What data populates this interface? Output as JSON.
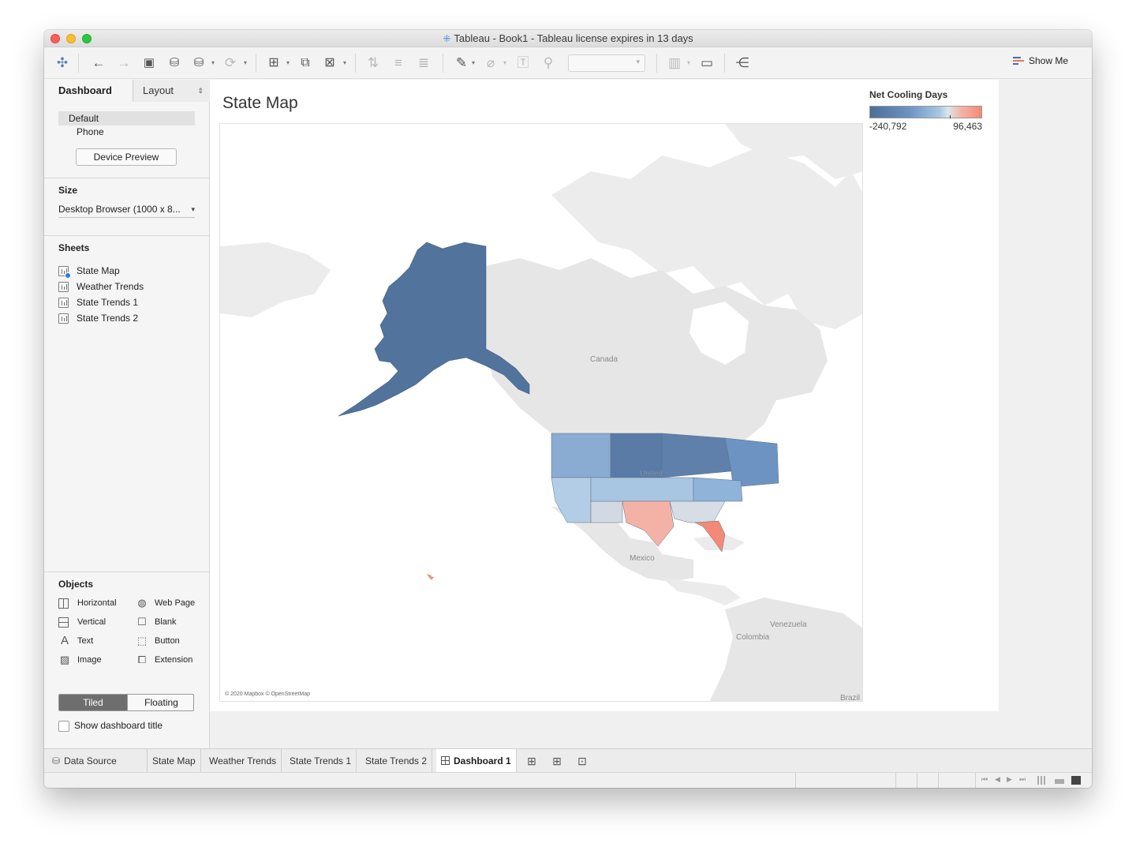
{
  "window": {
    "title": "Tableau - Book1 - Tableau license expires in 13 days"
  },
  "toolbar": {
    "show_me_label": "Show Me",
    "icons": [
      "tableau-logo-icon",
      "back-icon",
      "forward-icon",
      "save-icon",
      "new-data-source-icon",
      "pause-updates-icon",
      "refresh-icon",
      "new-worksheet-icon",
      "duplicate-sheet-icon",
      "clear-sheet-icon",
      "swap-icon",
      "sort-ascending-icon",
      "sort-descending-icon",
      "highlight-icon",
      "group-icon",
      "labels-icon",
      "fix-axes-icon",
      "fit-dropdown",
      "chart-type-icon",
      "presentation-icon",
      "share-icon"
    ]
  },
  "sidebar": {
    "tabs": {
      "dashboard": "Dashboard",
      "layout": "Layout"
    },
    "devices": {
      "default": "Default",
      "phone": "Phone",
      "preview_button": "Device Preview"
    },
    "size": {
      "title": "Size",
      "value": "Desktop Browser (1000 x 8..."
    },
    "sheets": {
      "title": "Sheets",
      "items": [
        "State Map",
        "Weather Trends",
        "State Trends 1",
        "State Trends 2"
      ]
    },
    "objects": {
      "title": "Objects",
      "items": [
        "Horizontal",
        "Web Page",
        "Vertical",
        "Blank",
        "Text",
        "Button",
        "Image",
        "Extension"
      ]
    },
    "mode": {
      "tiled": "Tiled",
      "floating": "Floating",
      "selected": "Tiled"
    },
    "show_title": {
      "label": "Show dashboard title",
      "checked": false
    }
  },
  "dashboard": {
    "title": "State Map",
    "map": {
      "labels": {
        "canada": "Canada",
        "mexico": "Mexico",
        "venezuela": "Venezuela",
        "colombia": "Colombia",
        "brazil": "Brazil",
        "united_states": "United"
      },
      "attribution": "© 2020 Mapbox © OpenStreetMap"
    },
    "legend": {
      "title": "Net Cooling Days",
      "min": "-240,792",
      "max": "96,463",
      "colors": {
        "low": "#4d6e98",
        "mid": "#dce5ee",
        "high": "#f28a77"
      }
    }
  },
  "sheet_tabs": {
    "items": [
      "Data Source",
      "State Map",
      "Weather Trends",
      "State Trends 1",
      "State Trends 2",
      "Dashboard 1"
    ],
    "active": "Dashboard 1"
  }
}
